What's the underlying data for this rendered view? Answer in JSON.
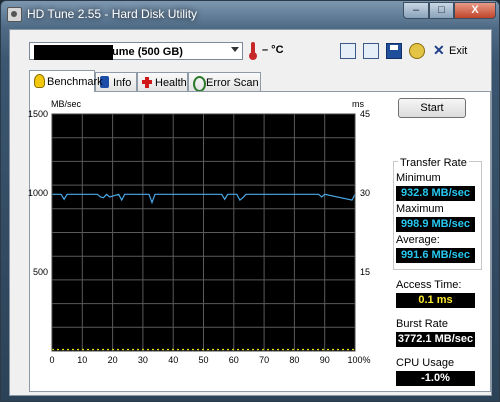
{
  "window": {
    "title": "HD Tune 2.55 - Hard Disk Utility",
    "min_label": "–",
    "max_label": "□",
    "close_label": "X"
  },
  "toolbar": {
    "drive": "Intel   Raid 0 Volume (500 GB)",
    "temperature": "– °C",
    "exit_label": "Exit",
    "exit_glyph": "✕"
  },
  "tabs": [
    {
      "label": "Benchmark",
      "icon": "lightbulb-icon"
    },
    {
      "label": "Info",
      "icon": "info-icon"
    },
    {
      "label": "Health",
      "icon": "health-cross-icon"
    },
    {
      "label": "Error Scan",
      "icon": "magnifier-icon"
    }
  ],
  "start_label": "Start",
  "results": {
    "transfer_rate_title": "Transfer Rate",
    "minimum_label": "Minimum",
    "minimum_value": "932.8 MB/sec",
    "maximum_label": "Maximum",
    "maximum_value": "998.9 MB/sec",
    "average_label": "Average:",
    "average_value": "991.6 MB/sec",
    "access_label": "Access Time:",
    "access_value": "0.1 ms",
    "burst_label": "Burst Rate",
    "burst_value": "3772.1 MB/sec",
    "cpu_label": "CPU Usage",
    "cpu_value": "-1.0%"
  },
  "chart_data": {
    "type": "line",
    "ylabel_left": "MB/sec",
    "ylabel_right": "ms",
    "y_left_ticks": [
      "1500",
      "1000",
      "500"
    ],
    "y_left_range": [
      0,
      1500
    ],
    "y_right_ticks": [
      "45",
      "30",
      "15"
    ],
    "y_right_range": [
      0,
      45
    ],
    "x_ticks": [
      "0",
      "10",
      "20",
      "30",
      "40",
      "50",
      "60",
      "70",
      "80",
      "90",
      "100%"
    ],
    "x_range": [
      0,
      100
    ],
    "grid": true,
    "colors": {
      "background": "#000000",
      "grid": "#5a5a5a",
      "transfer": "#4aa8e8",
      "access": "#e6e600"
    },
    "series": [
      {
        "name": "Transfer Rate",
        "x": [
          0,
          3,
          4,
          5,
          15,
          16,
          17,
          18,
          19,
          22,
          23,
          24,
          32,
          33,
          34,
          45,
          56,
          57,
          58,
          61,
          62,
          63,
          64,
          88,
          89,
          90,
          99,
          100
        ],
        "y": [
          992,
          992,
          960,
          992,
          992,
          975,
          970,
          992,
          975,
          992,
          955,
          992,
          992,
          940,
          992,
          992,
          992,
          960,
          992,
          992,
          955,
          970,
          992,
          992,
          975,
          992,
          955,
          992
        ]
      },
      {
        "name": "Access Time",
        "x": [
          0,
          100
        ],
        "y": [
          0.1,
          0.1
        ]
      }
    ]
  }
}
